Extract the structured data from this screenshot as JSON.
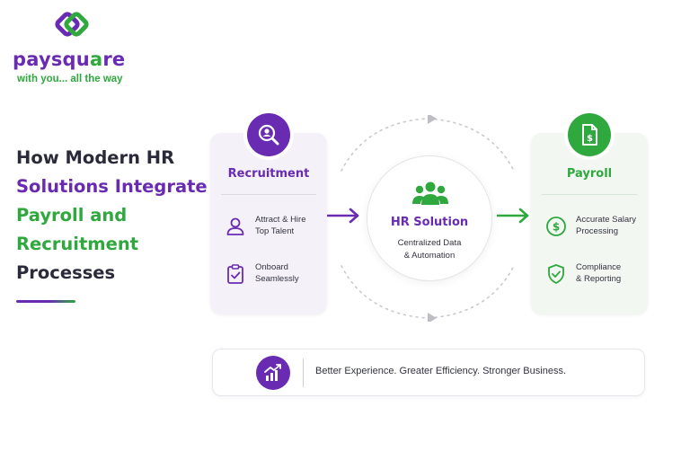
{
  "brand": {
    "wordmark_main": "paysqu",
    "wordmark_q": "a",
    "wordmark_end": "re",
    "tagline": "with you... all the way",
    "colors": {
      "purple": "#6a2bb3",
      "green": "#2fa83e",
      "dark": "#2a2a3a"
    }
  },
  "headline": {
    "line1": "How Modern HR",
    "line2": "Solutions Integrate",
    "line3": "Payroll and",
    "line4": "Recruitment",
    "line5": "Processes"
  },
  "recruitment": {
    "icon": "magnifier-person-icon",
    "title": "Recruitment",
    "items": [
      {
        "icon": "person-icon",
        "line1": "Attract & Hire",
        "line2": "Top Talent"
      },
      {
        "icon": "clipboard-check-icon",
        "line1": "Onboard",
        "line2": "Seamlessly"
      }
    ]
  },
  "hr_solution": {
    "icon": "team-icon",
    "title": "HR Solution",
    "line1": "Centralized Data",
    "line2": "& Automation"
  },
  "payroll": {
    "icon": "document-dollar-icon",
    "title": "Payroll",
    "items": [
      {
        "icon": "dollar-circle-icon",
        "line1": "Accurate Salary",
        "line2": "Processing"
      },
      {
        "icon": "shield-check-icon",
        "line1": "Compliance",
        "line2": "& Reporting"
      }
    ]
  },
  "footer": {
    "icon": "growth-chart-icon",
    "text": "Better Experience. Greater Efficiency. Stronger Business."
  }
}
